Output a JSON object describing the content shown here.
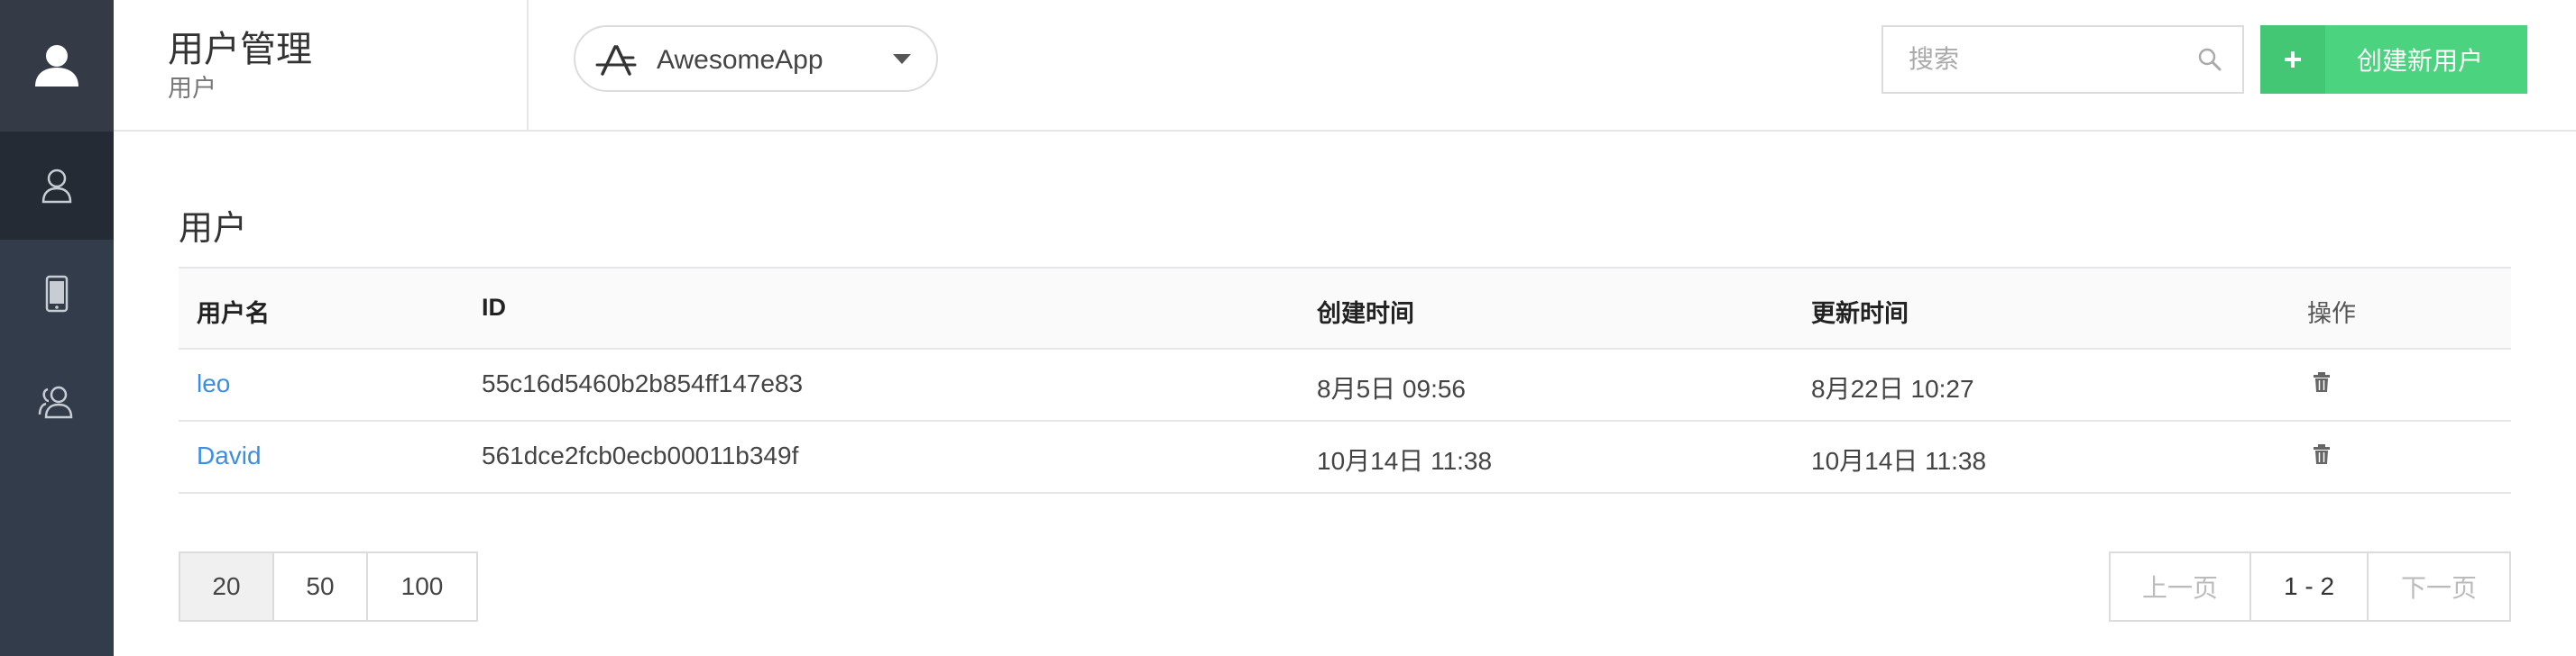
{
  "header": {
    "title": "用户管理",
    "subtitle": "用户",
    "app_selector": {
      "selected": "AwesomeApp",
      "icon": "app-store-icon"
    },
    "search": {
      "placeholder": "搜索",
      "value": ""
    },
    "create_button": {
      "label": "创建新用户",
      "icon": "plus-icon"
    }
  },
  "sidebar": {
    "items": [
      {
        "name": "account",
        "icon": "user-solid-icon",
        "active": false
      },
      {
        "name": "users",
        "icon": "user-outline-icon",
        "active": true
      },
      {
        "name": "devices",
        "icon": "mobile-icon",
        "active": false
      },
      {
        "name": "groups",
        "icon": "users-group-icon",
        "active": false
      }
    ]
  },
  "main": {
    "section_title": "用户",
    "table": {
      "columns": [
        "用户名",
        "ID",
        "创建时间",
        "更新时间",
        "操作"
      ],
      "rows": [
        {
          "username": "leo",
          "id": "55c16d5460b2b854ff147e83",
          "created": "8月5日 09:56",
          "updated": "8月22日 10:27",
          "action_icon": "trash-icon"
        },
        {
          "username": "David",
          "id": "561dce2fcb0ecb00011b349f",
          "created": "10月14日 11:38",
          "updated": "10月14日 11:38",
          "action_icon": "trash-icon"
        }
      ]
    },
    "page_sizes": [
      "20",
      "50",
      "100"
    ],
    "selected_page_size": "20",
    "pagination": {
      "prev": "上一页",
      "range": "1 - 2",
      "next": "下一页"
    }
  },
  "colors": {
    "sidebar_bg": "#333c4a",
    "sidebar_active": "#252b35",
    "accent_green": "#4cd37f",
    "link_blue": "#3a8ee6"
  }
}
